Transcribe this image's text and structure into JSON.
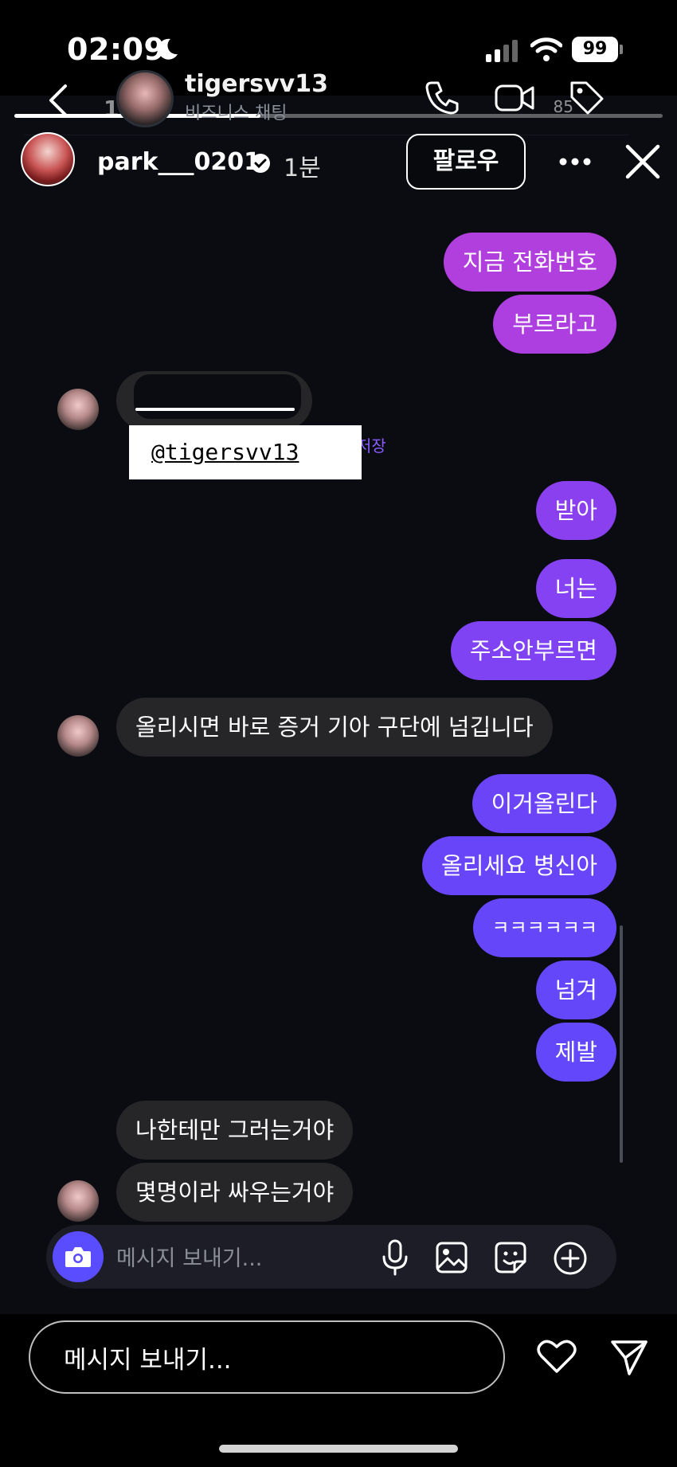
{
  "status_bar": {
    "time": "02:09",
    "battery": "99"
  },
  "inner_status": {
    "time": "1:47",
    "battery": "85"
  },
  "story": {
    "username": "park___0201",
    "time_ago": "1분",
    "follow_label": "팔로우",
    "progress": 0.38
  },
  "chat": {
    "name": "tigersvv13",
    "subtitle": "비즈니스 채팅",
    "handle_overlay": "@tigersvv13",
    "save_label": "저장",
    "messages": [
      {
        "dir": "out",
        "text": "지금 전화번호",
        "color": "#b13fde"
      },
      {
        "dir": "out",
        "text": "부르라고",
        "color": "#ad3fe0"
      },
      {
        "dir": "out",
        "text": "받아",
        "color": "#8b40f0"
      },
      {
        "dir": "out",
        "text": "너는",
        "color": "#8542f2"
      },
      {
        "dir": "out",
        "text": "주소안부르면",
        "color": "#8043f3"
      },
      {
        "dir": "in",
        "text": "올리시면 바로 증거 기아 구단에 넘깁니다"
      },
      {
        "dir": "out",
        "text": "이거올린다",
        "color": "#6b44f8"
      },
      {
        "dir": "out",
        "text": "올리세요 병신아",
        "color": "#6845f8"
      },
      {
        "dir": "out",
        "text": "ㅋㅋㅋㅋㅋㅋ",
        "color": "#6646f9"
      },
      {
        "dir": "out",
        "text": "넘겨",
        "color": "#6447f9"
      },
      {
        "dir": "out",
        "text": "제발",
        "color": "#6248fa"
      },
      {
        "dir": "in",
        "text": "나한테만 그러는거야"
      },
      {
        "dir": "in",
        "text": "몇명이라 싸우는거야"
      }
    ],
    "composer_placeholder": "메시지 보내기..."
  },
  "reply": {
    "placeholder": "메시지 보내기..."
  },
  "colors": {
    "accent": "#5a4cff",
    "incoming_bubble": "#262629"
  }
}
